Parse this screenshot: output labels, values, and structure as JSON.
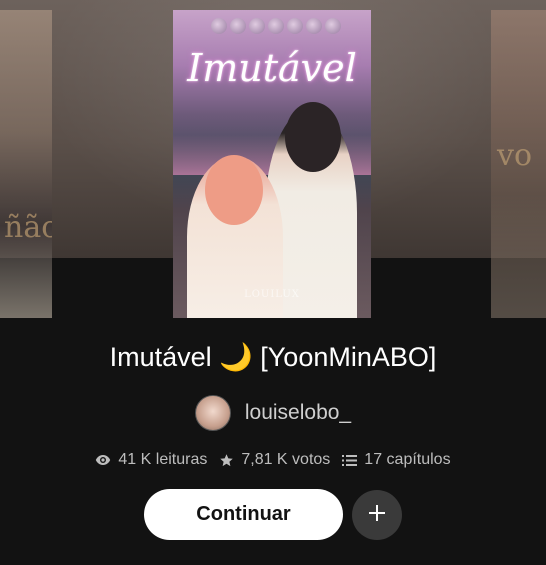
{
  "story": {
    "cover_title": "Imutável",
    "cover_watermark": "LOUILUX",
    "title": "Imutável 🌙 [YoonMinABO]",
    "author": "louiselobo_",
    "stats": {
      "reads": "41 K leituras",
      "votes": "7,81 K votos",
      "chapters": "17 capítulos"
    }
  },
  "side_covers": {
    "left_text": "ñão",
    "right_text": "vo"
  },
  "actions": {
    "continue_label": "Continuar",
    "add_label": "+"
  },
  "icons": {
    "reads": "eye-icon",
    "votes": "star-icon",
    "chapters": "list-icon",
    "add": "plus-icon"
  }
}
